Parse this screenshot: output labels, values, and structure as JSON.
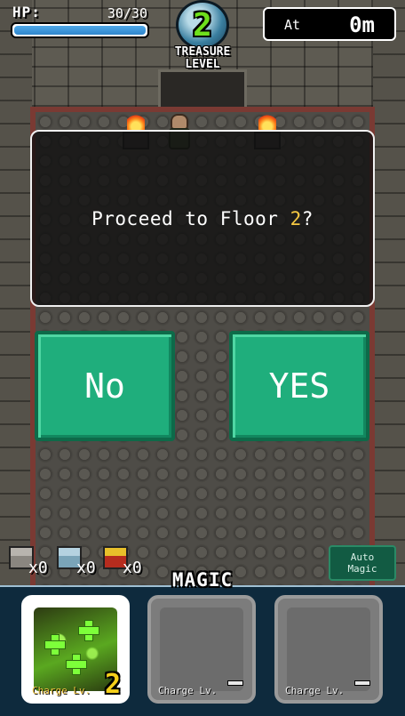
{
  "hud": {
    "hp_label": "HP:",
    "hp_value": "30/30",
    "hp_fraction": 1.0,
    "treasure_level_number": "2",
    "treasure_level_caption_1": "TREASURE",
    "treasure_level_caption_2": "LEVEL",
    "depth_prefix": "At",
    "depth_value": "0m"
  },
  "dialog": {
    "message_prefix": "Proceed to Floor ",
    "floor_number": "2",
    "message_suffix": "?"
  },
  "buttons": {
    "no_label": "No",
    "yes_label": "YES"
  },
  "items": [
    {
      "icon": "wood-chest-icon",
      "count": "x0"
    },
    {
      "icon": "silver-chest-icon",
      "count": "x0"
    },
    {
      "icon": "gold-chest-icon",
      "count": "x0"
    }
  ],
  "auto_magic": {
    "line1": "Auto",
    "line2": "Magic"
  },
  "magic": {
    "title": "MAGIC",
    "slots": [
      {
        "charge_label": "Charge Lv.",
        "level": "2",
        "icon": "heal-spell-icon"
      },
      {
        "charge_label": "Charge Lv.",
        "level": "-",
        "icon": "empty-slot"
      },
      {
        "charge_label": "Charge Lv.",
        "level": "-",
        "icon": "empty-slot"
      }
    ]
  },
  "colors": {
    "button_green": "#1fae7c",
    "floor_highlight": "#f5c842",
    "hp_blue": "#2f86cc"
  }
}
